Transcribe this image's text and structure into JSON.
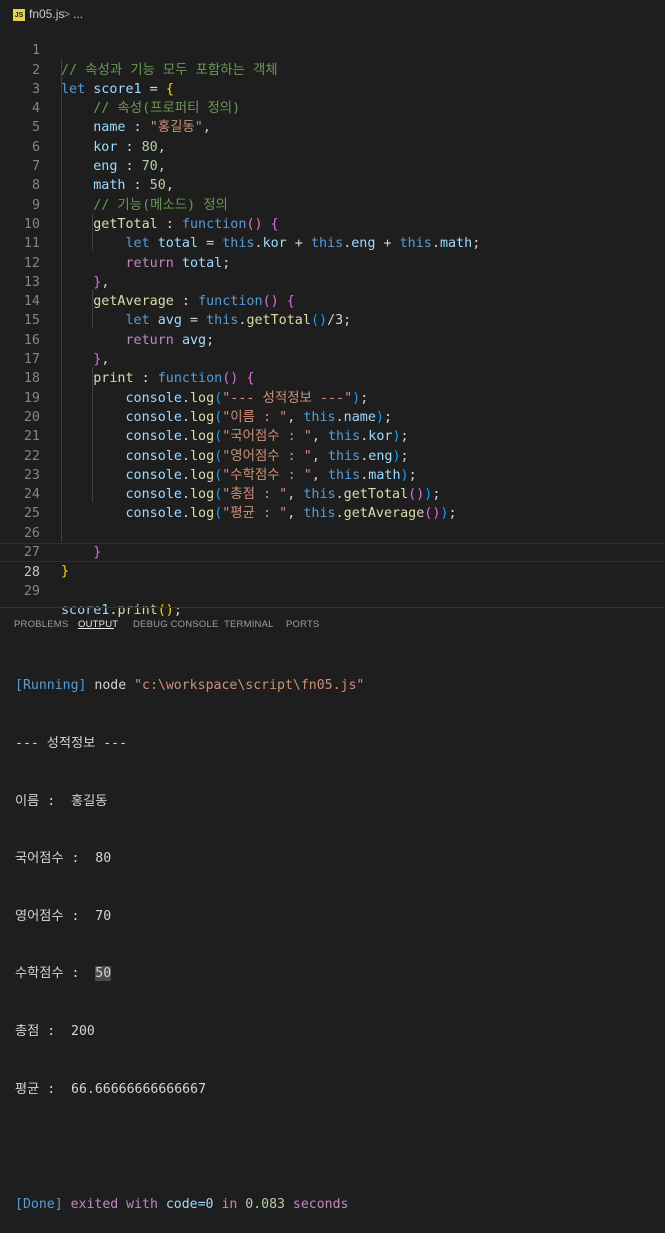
{
  "breadcrumb": {
    "file_icon": "JS",
    "file": "fn05.js",
    "separator": ">",
    "rest": "..."
  },
  "editor": {
    "line_numbers": [
      "1",
      "2",
      "3",
      "4",
      "5",
      "6",
      "7",
      "8",
      "9",
      "10",
      "11",
      "12",
      "13",
      "14",
      "15",
      "16",
      "17",
      "18",
      "19",
      "20",
      "21",
      "22",
      "23",
      "24",
      "25",
      "26",
      "27",
      "28",
      "29"
    ],
    "current_line": "28",
    "code": {
      "l1_comment": "// 속성과 기능 모두 포함하는 객체",
      "let": "let",
      "score1": "score1",
      "eq": " = ",
      "open_brace": "{",
      "l3_comment": "// 속성(프로퍼티 정의)",
      "name_key": "name",
      "colon": " : ",
      "name_val": "\"홍길동\"",
      "comma": ",",
      "kor_key": "kor",
      "kor_val": "80",
      "eng_key": "eng",
      "eng_val": "70",
      "math_key": "math",
      "math_val": "50",
      "l8_comment": "// 기능(메소드) 정의",
      "getTotal": "getTotal",
      "function": "function",
      "parens": "()",
      "sp_brace": " {",
      "total": "total",
      "this": "this",
      "dot_kor": "kor",
      "plus": " + ",
      "dot_eng": "eng",
      "dot_math": "math",
      "dot": ".",
      "semi": ";",
      "return": "return",
      "close_brace": "}",
      "close_brace_comma": "},",
      "getAverage": "getAverage",
      "avg": "avg",
      "getTotalCall": "getTotal",
      "div3": "/3;",
      "print": "print",
      "console": "console",
      "log": "log",
      "lp": "(",
      "rp": ")",
      "s18": "\"--- 성적정보 ---\"",
      "s19": "\"이름 : \"",
      "s20": "\"국어점수 : \"",
      "s21": "\"영어점수 : \"",
      "s22": "\"수학점수 : \"",
      "s23": "\"총점 : \"",
      "s24": "\"평균 : \"",
      "comma_sp": ", ",
      "dot_name": "name",
      "getAverageCall": "getAverage",
      "print_call": "print",
      "l29_end": ";"
    }
  },
  "panel": {
    "tabs": [
      "PROBLEMS",
      "OUTPUT",
      "DEBUG CONSOLE",
      "TERMINAL",
      "PORTS"
    ],
    "active_tab": "OUTPUT"
  },
  "output": {
    "running_tag": "[Running]",
    "running_cmd": " node ",
    "running_path": "\"c:\\workspace\\script\\fn05.js\"",
    "line_header": "--- 성적정보 ---",
    "line_name": "이름 :  홍길동",
    "line_kor_label": "국어점수 :  ",
    "line_kor_val": "80",
    "line_eng_label": "영어점수 :  ",
    "line_eng_val": "70",
    "line_math_label": "수학점수 :  ",
    "line_math_val": "50",
    "line_total_label": "총점 :  ",
    "line_total_val": "200",
    "line_avg_label": "평균 :  ",
    "line_avg_val": "66.66666666666667",
    "done_tag": "[Done]",
    "done_text1": " exited with ",
    "done_code": "code=0",
    "done_text2": " in ",
    "done_time": "0.083",
    "done_text3": " seconds"
  }
}
